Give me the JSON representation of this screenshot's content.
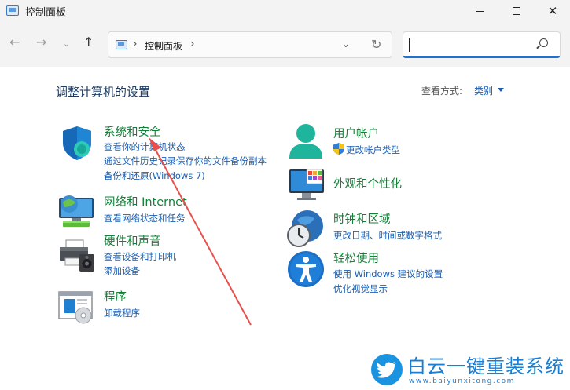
{
  "window": {
    "title": "控制面板",
    "minimize_glyph": "",
    "close_glyph": "✕"
  },
  "nav": {
    "back_glyph": "←",
    "forward_glyph": "→",
    "recent_glyph": "⌄",
    "up_glyph": "↑",
    "sep_glyph": "›",
    "breadcrumb": "控制面板",
    "dropdown_glyph": "⌄",
    "refresh_glyph": "↻",
    "search_value": ""
  },
  "main": {
    "heading": "调整计算机的设置",
    "view_label": "查看方式:",
    "view_value": "类别"
  },
  "categories_left": [
    {
      "title": "系统和安全",
      "links": [
        "查看你的计算机状态",
        "通过文件历史记录保存你的文件备份副本",
        "备份和还原(Windows 7)"
      ]
    },
    {
      "title": "网络和 Internet",
      "links": [
        "查看网络状态和任务"
      ]
    },
    {
      "title": "硬件和声音",
      "links": [
        "查看设备和打印机",
        "添加设备"
      ]
    },
    {
      "title": "程序",
      "links": [
        "卸载程序"
      ]
    }
  ],
  "categories_right": [
    {
      "title": "用户帐户",
      "links": [
        "更改帐户类型"
      ]
    },
    {
      "title": "外观和个性化",
      "links": []
    },
    {
      "title": "时钟和区域",
      "links": [
        "更改日期、时间或数字格式"
      ]
    },
    {
      "title": "轻松使用",
      "links": [
        "使用 Windows 建议的设置",
        "优化视觉显示"
      ]
    }
  ],
  "annotation": {
    "color": "#e8504d"
  },
  "watermark": {
    "title": "白云一键重装系统",
    "url": "www.baiyunxitong.com",
    "color": "#1a7fd4"
  },
  "colors": {
    "title_green": "#137f37",
    "link_blue": "#1a5fb4",
    "heading": "#1e3a5f"
  }
}
